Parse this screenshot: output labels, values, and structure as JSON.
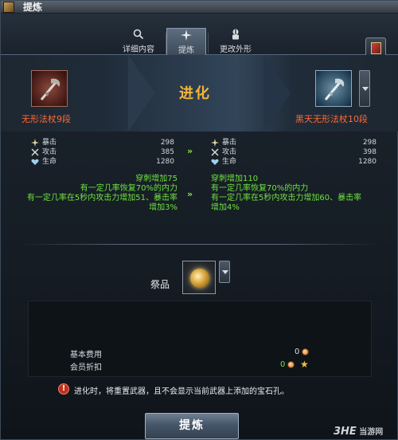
{
  "window": {
    "title": "提炼"
  },
  "tabs": [
    {
      "label": "详细内容",
      "icon": "search-icon"
    },
    {
      "label": "提炼",
      "icon": "sparkle-icon",
      "active": true
    },
    {
      "label": "更改外形",
      "icon": "wardrobe-icon"
    }
  ],
  "evolve": {
    "label": "进化",
    "source_item": "无形法杖9段",
    "target_item": "黑天无形法杖10段"
  },
  "stats": {
    "labels": [
      "暴击",
      "攻击",
      "生命"
    ],
    "icons": [
      "crit-icon",
      "attack-icon",
      "health-icon"
    ],
    "before": [
      "298",
      "385",
      "1280"
    ],
    "after": [
      "298",
      "398",
      "1280"
    ],
    "arrow": "»"
  },
  "effects": {
    "before": [
      "穿刺增加75",
      "有一定几率恢复70%的内力",
      "有一定几率在5秒内攻击力增加51、暴击率",
      "增加3%"
    ],
    "after": [
      "穿刺增加110",
      "有一定几率恢复70%的内力",
      "有一定几率在5秒内攻击力增加60、暴击率",
      "增加4%"
    ]
  },
  "sacrifice": {
    "label": "祭品"
  },
  "costs": {
    "base_fee_label": "基本费用",
    "base_fee_value": "0",
    "member_discount_label": "会员折扣",
    "member_discount_value": "0"
  },
  "warning": {
    "icon": "!",
    "text": "进化时，将重置武器，且不会显示当前武器上添加的宝石孔。"
  },
  "action": {
    "refine_label": "提炼"
  },
  "watermark": {
    "logo": "3HE",
    "text": "当游网"
  },
  "colors": {
    "item_name": "#ff6a37",
    "evolve_label": "#f2b53a",
    "effect_text": "#6ee23d"
  }
}
